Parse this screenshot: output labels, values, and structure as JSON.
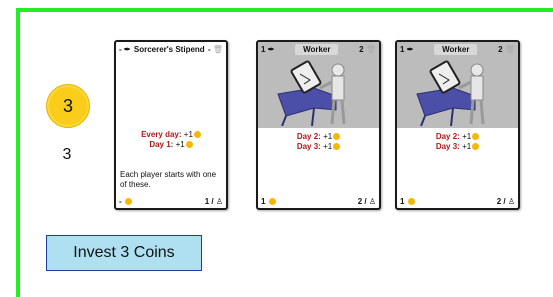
{
  "status": {
    "coin_value": "3",
    "coin_count": "3"
  },
  "cards": [
    {
      "cost": "-",
      "title": "Sorcerer's Stipend",
      "slot": "-",
      "effects": [
        {
          "label": "Every day:",
          "value": "+1"
        },
        {
          "label": "Day 1:",
          "value": "+1"
        }
      ],
      "description": "Each player starts with one of these.",
      "footer_left": "-",
      "footer_right": "1 /"
    },
    {
      "cost": "1",
      "title": "Worker",
      "slot": "2",
      "effects": [
        {
          "label": "Day 2:",
          "value": "+1"
        },
        {
          "label": "Day 3:",
          "value": "+1"
        }
      ],
      "description": "",
      "footer_left": "1",
      "footer_right": "2 /"
    },
    {
      "cost": "1",
      "title": "Worker",
      "slot": "2",
      "effects": [
        {
          "label": "Day 2:",
          "value": "+1"
        },
        {
          "label": "Day 3:",
          "value": "+1"
        }
      ],
      "description": "",
      "footer_left": "1",
      "footer_right": "2 /"
    }
  ],
  "actions": {
    "invest_label": "Invest 3 Coins"
  },
  "colors": {
    "frame": "#22ee22",
    "coin": "#f9cd1a",
    "button_bg": "#aee0f2",
    "effect_text": "#b01818"
  }
}
